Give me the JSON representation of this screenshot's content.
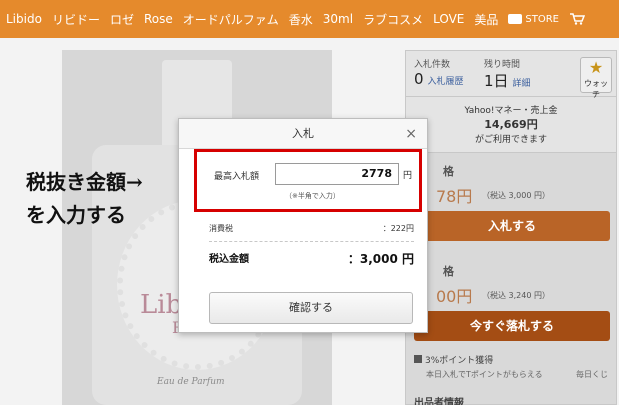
{
  "topbar": {
    "keywords": [
      "Libido",
      "リビドー",
      "ロゼ",
      "Rose",
      "オードパルファム",
      "香水",
      "30ml",
      "ラブコスメ",
      "LOVE",
      "美品"
    ],
    "store_label": "STORE"
  },
  "product": {
    "brand": "Lib",
    "brand_line2": "R",
    "edp": "Eau de Parfum"
  },
  "panel": {
    "bids_label": "入札件数",
    "bids_count": "0",
    "bid_history_link": "入札履歴",
    "time_left_label": "残り時間",
    "time_left_value": "1日",
    "detail_link": "詳細",
    "watch_label": "ウォッチ",
    "yahoo_line1": "Yahoo!マネー・売上金",
    "yahoo_amount": "14,669円",
    "yahoo_line3": "がご利用できます",
    "current_label": "格",
    "current_price": "78円",
    "current_tax": "（税込 3,000 円）",
    "bid_button": "入札する",
    "buynow_label": "格",
    "buynow_price": "00円",
    "buynow_tax": "（税込 3,240 円）",
    "buynow_button": "今すぐ落札する",
    "point_text": "3%ポイント獲得",
    "point_note": "本日入札でTポイントがもらえる",
    "point_note2": "毎日くじ",
    "seller_label": "出品者情報"
  },
  "annotation": {
    "line1": "税抜き金額→",
    "line2": "を入力する"
  },
  "modal": {
    "title": "入札",
    "close": "×",
    "max_bid_label": "最高入札額",
    "max_bid_value": "2778",
    "yen": "円",
    "hint": "（※半角で入力）",
    "tax_label": "消費税",
    "tax_value": "：222円",
    "total_label": "税込金額",
    "total_value": "：3,000 円",
    "confirm_button": "確認する"
  },
  "colors": {
    "topbar": "#e58a2c",
    "accent_red": "#d60000",
    "bid_button": "#b96427",
    "buy_button": "#a44d14"
  }
}
